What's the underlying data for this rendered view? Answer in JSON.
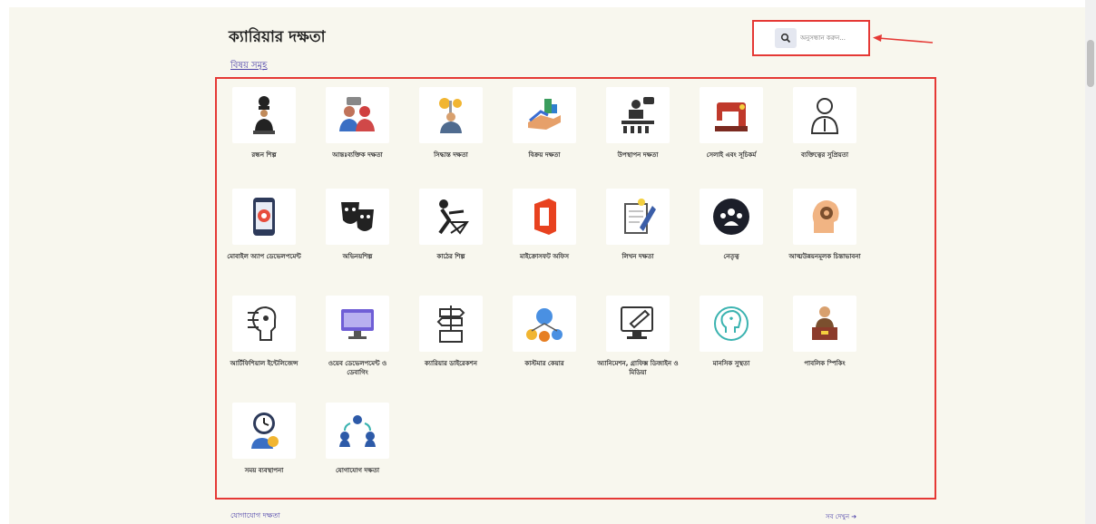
{
  "header": {
    "title": "ক্যারিয়ার দক্ষতা",
    "subtitle_link": "বিষয় সমূহ"
  },
  "search": {
    "placeholder": "অনুসন্ধান করুন...",
    "icon": "search-icon"
  },
  "colors": {
    "highlight": "#e53935",
    "link": "#4a3fa8",
    "page_bg": "#f8f7ee"
  },
  "skills": [
    {
      "label": "রন্ধন শিল্প",
      "icon": "chef-icon"
    },
    {
      "label": "আন্তঃব্যক্তিক দক্ষতা",
      "icon": "interpersonal-icon"
    },
    {
      "label": "সিদ্ধান্ত দক্ষতা",
      "icon": "decision-icon"
    },
    {
      "label": "বিক্রয় দক্ষতা",
      "icon": "sales-icon"
    },
    {
      "label": "উপস্থাপন দক্ষতা",
      "icon": "presentation-icon"
    },
    {
      "label": "সেলাই এবং সূচিকর্ম",
      "icon": "sewing-machine-icon"
    },
    {
      "label": "ব্যক্তিত্বের সুপ্রিয়তা",
      "icon": "person-icon"
    },
    {
      "label": "মোবাইল অ্যাপ ডেভেলপমেন্ট",
      "icon": "mobile-app-icon"
    },
    {
      "label": "অভিনয়শিল্প",
      "icon": "theater-masks-icon"
    },
    {
      "label": "কাঠের শিল্প",
      "icon": "woodwork-icon"
    },
    {
      "label": "মাইক্রোসফট অফিস",
      "icon": "office-icon"
    },
    {
      "label": "লিখন দক্ষতা",
      "icon": "writing-icon"
    },
    {
      "label": "নেতৃত্ব",
      "icon": "leadership-icon"
    },
    {
      "label": "আত্মউন্নয়নমূলক চিন্তাভাবনা",
      "icon": "mind-icon"
    },
    {
      "label": "আর্টিফিশিয়াল ইন্টেলিজেন্স",
      "icon": "ai-icon"
    },
    {
      "label": "ওয়েব ডেভেলপমেন্ট ও ডেবাগিং",
      "icon": "web-dev-icon"
    },
    {
      "label": "ক্যারিয়ার ডাইরেকশন",
      "icon": "career-direction-icon"
    },
    {
      "label": "কাস্টমার কেয়ার",
      "icon": "network-icon"
    },
    {
      "label": "অ্যানিমেশন, গ্রাফিক্স ডিজাইন ও মিডিয়া",
      "icon": "graphic-design-icon"
    },
    {
      "label": "মানসিক সুস্থতা",
      "icon": "mental-health-icon"
    },
    {
      "label": "পাবলিক স্পিকিং",
      "icon": "public-speaking-icon"
    },
    {
      "label": "সময় ব্যবস্থাপনা",
      "icon": "time-management-icon"
    },
    {
      "label": "যোগাযোগ দক্ষতা",
      "icon": "communication-icon"
    }
  ],
  "footer": {
    "left_link": "যোগাযোগ দক্ষতা",
    "more_link": "সব দেখুন ➔"
  }
}
